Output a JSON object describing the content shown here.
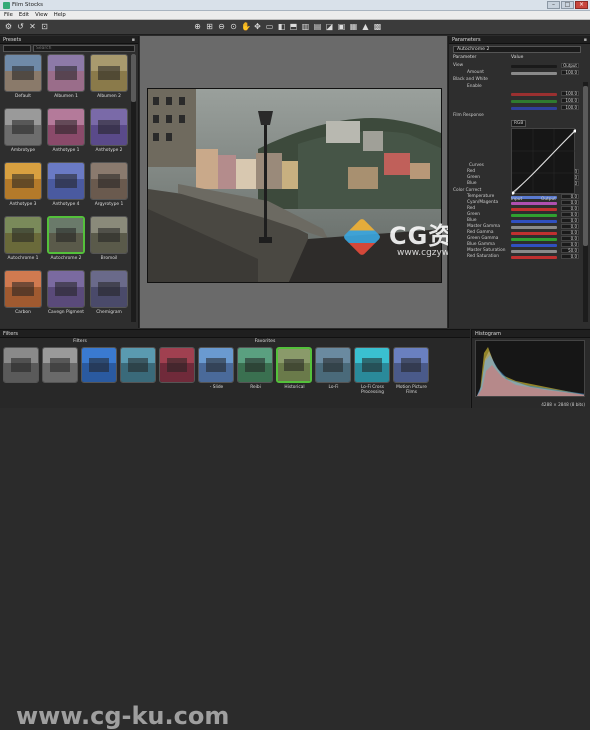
{
  "window": {
    "title": "Film Stocks"
  },
  "menu": [
    "File",
    "Edit",
    "View",
    "Help"
  ],
  "presets_panel": {
    "title": "Presets",
    "search_placeholder": "Search",
    "items": [
      {
        "label": "Default",
        "sky": "#6f8aa8",
        "ground": "#8a7a6a"
      },
      {
        "label": "Albumen 1",
        "sky": "#8d7aa8",
        "ground": "#9a6d8a"
      },
      {
        "label": "Albumen 2",
        "sky": "#a89a6e",
        "ground": "#8a7a4a"
      },
      {
        "label": "Ambrotype",
        "sky": "#9a9a9a",
        "ground": "#6d6d6d"
      },
      {
        "label": "Anthotype 1",
        "sky": "#b47a9a",
        "ground": "#8a4a6a"
      },
      {
        "label": "Anthotype 2",
        "sky": "#7a6aa8",
        "ground": "#5a4a8a"
      },
      {
        "label": "Anthotype 3",
        "sky": "#d8a040",
        "ground": "#b47a2a"
      },
      {
        "label": "Anthotype 4",
        "sky": "#6a7ac4",
        "ground": "#4a5aa0"
      },
      {
        "label": "Argyrotype 1",
        "sky": "#8a7a6e",
        "ground": "#6a5a4e"
      },
      {
        "label": "Autochrome 1",
        "sky": "#7a8a5a",
        "ground": "#6a6a3a"
      },
      {
        "label": "Autochrome 2",
        "sky": "#6a7a6a",
        "ground": "#5a5a4a"
      },
      {
        "label": "Bromoil",
        "sky": "#8a8a7a",
        "ground": "#5a5a4a"
      },
      {
        "label": "Carbon",
        "sky": "#d07a50",
        "ground": "#a05a30"
      },
      {
        "label": "Cavegn Pigment",
        "sky": "#7a6aa0",
        "ground": "#5a4a7a"
      },
      {
        "label": "Chemigram",
        "sky": "#6a6a8a",
        "ground": "#4a4a6a"
      }
    ],
    "tabs": [
      "Presets",
      "Effect"
    ]
  },
  "parameters_panel": {
    "title": "Parameters",
    "selected": "Autochrome 2",
    "col_param": "Parameter",
    "col_value": "Value",
    "rows": [
      {
        "name": "View",
        "indent": false,
        "value": "Output",
        "color": "#1a1a1a"
      },
      {
        "name": "Amount",
        "indent": true,
        "value": "100.0",
        "color": "#8a8a8a"
      },
      {
        "name": "Black and White",
        "indent": false,
        "value": "",
        "color": ""
      },
      {
        "name": "Enable",
        "indent": true,
        "value": "",
        "color": ""
      },
      {
        "name": "",
        "indent": true,
        "value": "100.0",
        "color": "#9a3030"
      },
      {
        "name": "",
        "indent": true,
        "value": "100.0",
        "color": "#2f7a2f"
      },
      {
        "name": "",
        "indent": true,
        "value": "100.0",
        "color": "#2f3f9a"
      },
      {
        "name": "Film Response",
        "indent": false,
        "value": "",
        "color": ""
      },
      {
        "name": "RGB",
        "indent": true,
        "value": "",
        "color": ""
      },
      {
        "name": "Red",
        "indent": true,
        "value": "0.0",
        "color": "#a03030"
      },
      {
        "name": "Green",
        "indent": true,
        "value": "0.0",
        "color": "#308030"
      },
      {
        "name": "Blue",
        "indent": true,
        "value": "0.0",
        "color": "#303090"
      },
      {
        "name": "Color Correct",
        "indent": false,
        "value": "",
        "color": ""
      },
      {
        "name": "Temperature",
        "indent": true,
        "value": "0.0",
        "color": "#5a7ad0"
      },
      {
        "name": "Cyan/Magenta",
        "indent": true,
        "value": "0.0",
        "color": "#b050b0"
      },
      {
        "name": "Red",
        "indent": true,
        "value": "0.0",
        "color": "#c03030"
      },
      {
        "name": "Green",
        "indent": true,
        "value": "0.0",
        "color": "#30a030"
      },
      {
        "name": "Blue",
        "indent": true,
        "value": "0.0",
        "color": "#3050c0"
      },
      {
        "name": "Master Gamma",
        "indent": true,
        "value": "0.0",
        "color": "#8a8a8a"
      },
      {
        "name": "Red Gamma",
        "indent": true,
        "value": "0.0",
        "color": "#c03030"
      },
      {
        "name": "Green Gamma",
        "indent": true,
        "value": "0.0",
        "color": "#30a030"
      },
      {
        "name": "Blue Gamma",
        "indent": true,
        "value": "0.0",
        "color": "#3050c0"
      },
      {
        "name": "Master Saturation",
        "indent": true,
        "value": "50.0",
        "color": "#8a8a8a"
      },
      {
        "name": "Red Saturation",
        "indent": true,
        "value": "0.0",
        "color": "#c03030"
      }
    ],
    "curves_label": "Curves",
    "curves_mode": "RGB",
    "input_label": "Input",
    "output_label": "Output"
  },
  "filters_panel": {
    "title": "Filters",
    "tab_filters": "Filters",
    "tab_favorites": "Favorites",
    "items": [
      {
        "label": "",
        "sky": "#8a8a8a",
        "ground": "#5a5a5a"
      },
      {
        "label": "",
        "sky": "#9a9a9a",
        "ground": "#6a6a6a"
      },
      {
        "label": "",
        "sky": "#3a7ad0",
        "ground": "#2a5aa0"
      },
      {
        "label": "",
        "sky": "#5a9ab0",
        "ground": "#3a6a7a"
      },
      {
        "label": "",
        "sky": "#a04050",
        "ground": "#702a3a"
      },
      {
        "label": "- Slide",
        "sky": "#6a9ad0",
        "ground": "#4a6a9a"
      },
      {
        "label": "Reibi",
        "sky": "#5aa080",
        "ground": "#3a7050"
      },
      {
        "label": "Historical",
        "sky": "#8a9a6a",
        "ground": "#6a7a4a"
      },
      {
        "label": "Lo-Fi",
        "sky": "#6a8aa0",
        "ground": "#4a6a7a"
      },
      {
        "label": "Lo-Fi Cross Processing",
        "sky": "#3ac0d0",
        "ground": "#2a8a9a"
      },
      {
        "label": "Motion Picture Films",
        "sky": "#6a80c0",
        "ground": "#4a5a8a"
      }
    ]
  },
  "histogram_panel": {
    "title": "Histogram",
    "status": "4288 × 2848 (8 bits)"
  },
  "watermarks": {
    "main": "CG资源站",
    "url": "www.cgzyw.com",
    "bottom": "www.cg-ku.com"
  }
}
